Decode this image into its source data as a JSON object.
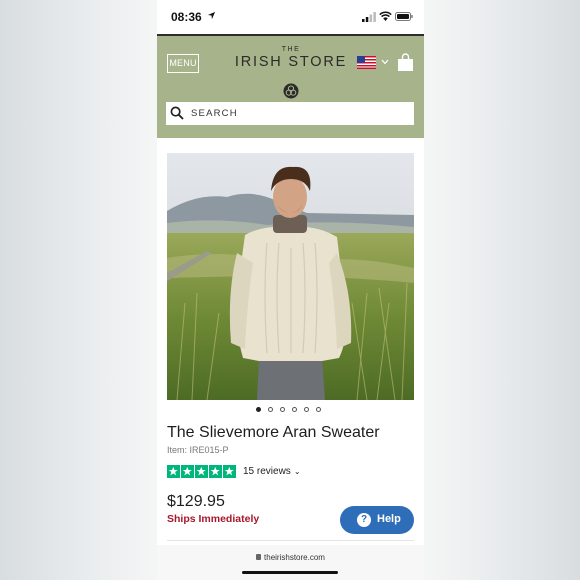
{
  "status_bar": {
    "time": "08:36"
  },
  "header": {
    "menu_label": "MENU",
    "logo_the": "THE",
    "logo_name": "IRISH STORE",
    "search_placeholder": "SEARCH"
  },
  "product": {
    "title": "The Slievemore Aran Sweater",
    "item_code": "Item: IRE015-P",
    "rating_stars": 5,
    "reviews": "15 reviews",
    "price": "$129.95",
    "shipping": "Ships Immediately",
    "carousel": {
      "total": 6,
      "active": 1
    }
  },
  "help_button": {
    "label": "Help"
  },
  "browser": {
    "url": "theirishstore.com"
  },
  "colors": {
    "header_bg": "#a7b38a",
    "stars": "#00b67a",
    "ships": "#a8172b",
    "help": "#2e6db8"
  }
}
